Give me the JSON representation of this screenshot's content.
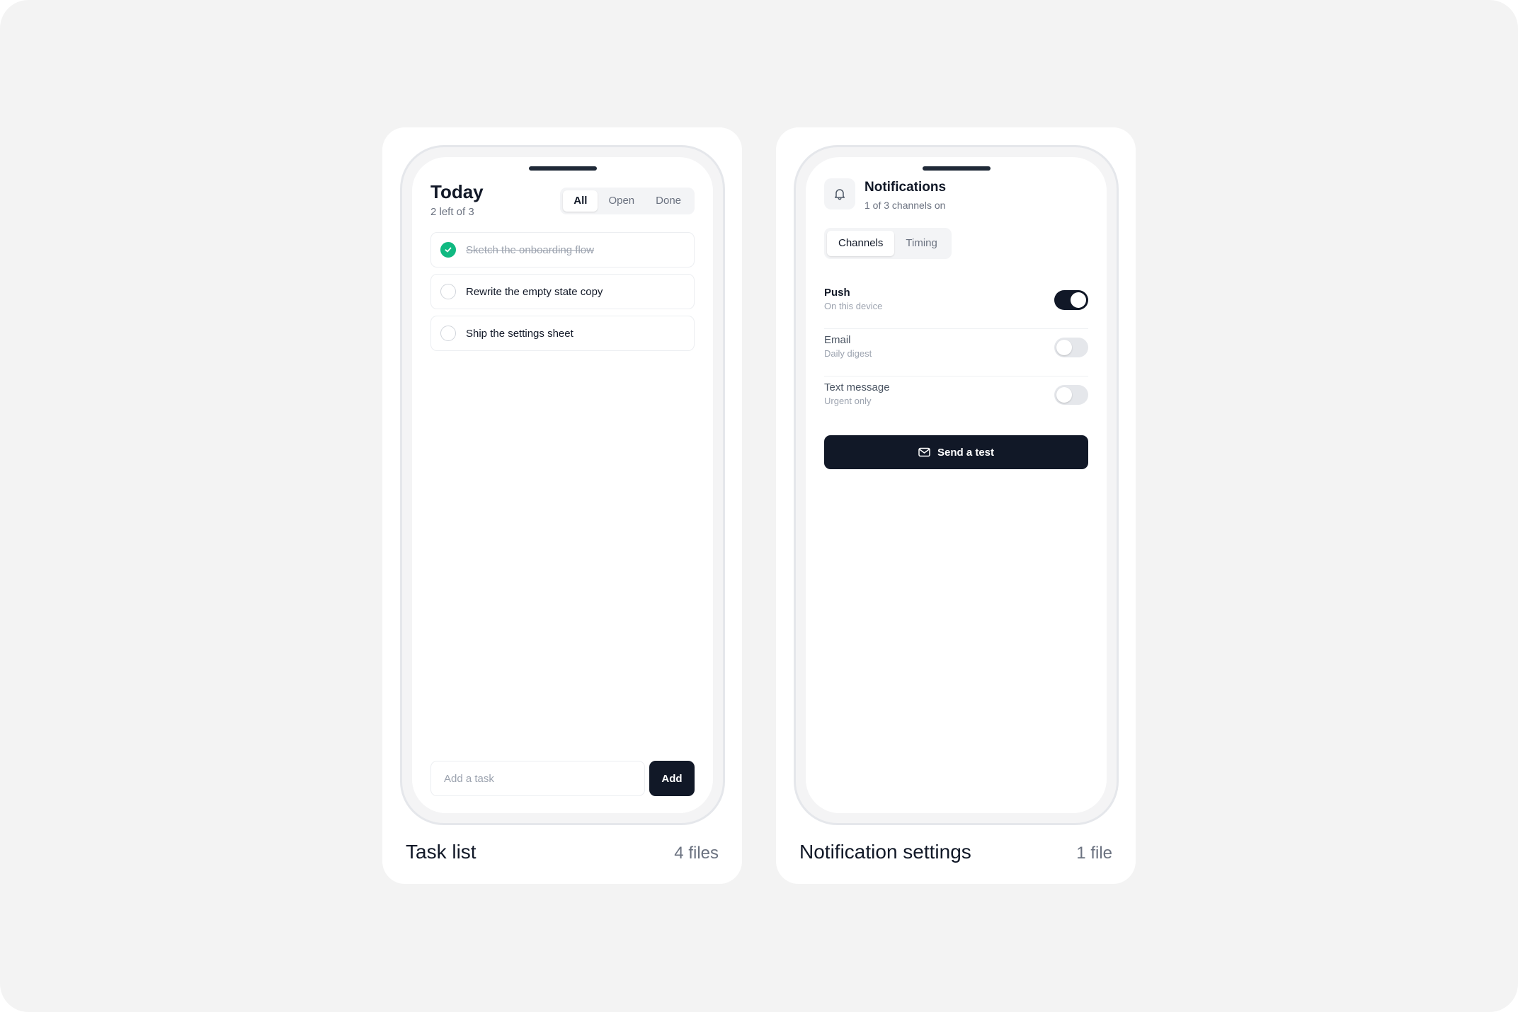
{
  "cards": {
    "task_list": {
      "footer_title": "Task list",
      "footer_count": "4 files",
      "header": {
        "title": "Today",
        "subtitle": "2 left of 3"
      },
      "filters": [
        "All",
        "Open",
        "Done"
      ],
      "active_filter": "All",
      "tasks": [
        {
          "text": "Sketch the onboarding flow",
          "done": true
        },
        {
          "text": "Rewrite the empty state copy",
          "done": false
        },
        {
          "text": "Ship the settings sheet",
          "done": false
        }
      ],
      "add_input": {
        "placeholder": "Add a task",
        "value": ""
      },
      "add_button_label": "Add"
    },
    "notifications": {
      "footer_title": "Notification settings",
      "footer_count": "1 file",
      "header": {
        "title": "Notifications",
        "subtitle": "1 of 3 channels on",
        "icon": "bell-icon"
      },
      "tabs": [
        "Channels",
        "Timing"
      ],
      "active_tab": "Channels",
      "channels": [
        {
          "name": "Push",
          "description": "On this device",
          "enabled": true
        },
        {
          "name": "Email",
          "description": "Daily digest",
          "enabled": false
        },
        {
          "name": "Text message",
          "description": "Urgent only",
          "enabled": false
        }
      ],
      "send_button": {
        "label": "Send a test",
        "icon": "mail-icon"
      }
    }
  },
  "colors": {
    "primary": "#111827",
    "success": "#10b981",
    "muted": "#6b7280",
    "canvas": "#f3f3f3"
  }
}
